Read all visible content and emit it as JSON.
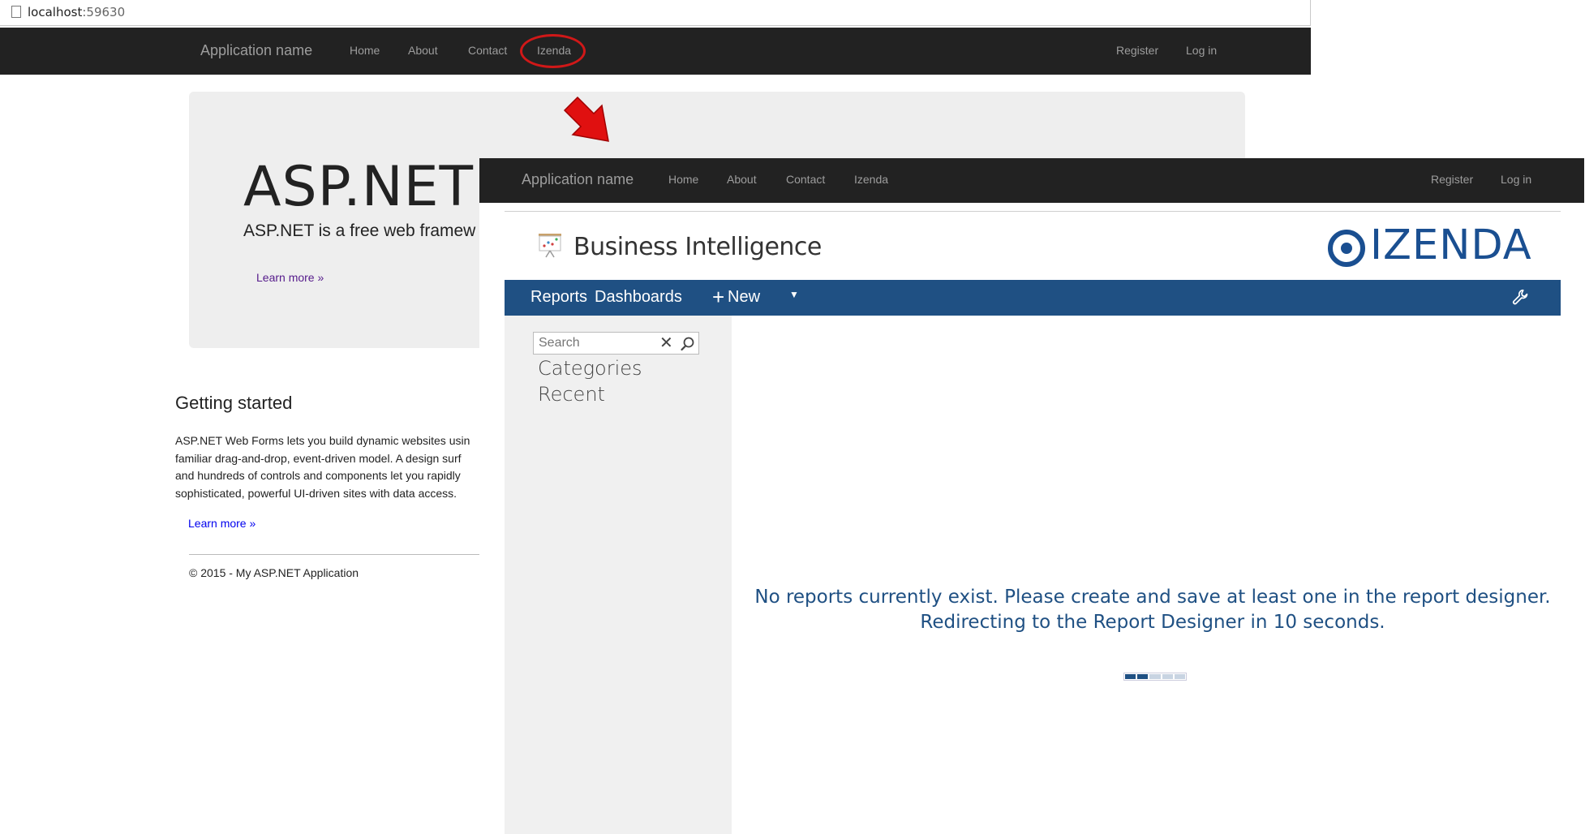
{
  "browser": {
    "url_host": "localhost",
    "url_port": ":59630"
  },
  "back_page": {
    "nav": {
      "brand": "Application name",
      "links": [
        "Home",
        "About",
        "Contact",
        "Izenda"
      ],
      "right_links": [
        "Register",
        "Log in"
      ]
    },
    "jumbotron": {
      "heading": "ASP.NET",
      "lead": "ASP.NET is a free web framew",
      "learn_more": "Learn more »"
    },
    "getting_started": {
      "title": "Getting started",
      "paragraph": "ASP.NET Web Forms lets you build dynamic websites usin\nfamiliar drag-and-drop, event-driven model. A design surf\nand hundreds of controls and components let you rapidly\nsophisticated, powerful UI-driven sites with data access.",
      "learn_more": "Learn more »"
    },
    "footer": "© 2015 - My ASP.NET Application"
  },
  "front_page": {
    "nav": {
      "brand": "Application name",
      "links": [
        "Home",
        "About",
        "Contact",
        "Izenda"
      ],
      "right_links": [
        "Register",
        "Log in"
      ]
    },
    "header": {
      "title": "Business Intelligence",
      "logo_text": "IZENDA"
    },
    "toolbar": {
      "reports": "Reports",
      "dashboards": "Dashboards",
      "new": "New"
    },
    "sidebar": {
      "search_placeholder": "Search",
      "categories": "Categories",
      "recent": "Recent"
    },
    "message": {
      "line1": "No reports currently exist. Please create and save at least one in the report designer.",
      "line2": "Redirecting to the Report Designer in 10 seconds."
    },
    "loader": {
      "segments_total": 5,
      "segments_active": 2
    }
  },
  "colors": {
    "navbar": "#222222",
    "toolbar": "#1f5083",
    "annotation": "#d01818",
    "message": "#1f5083"
  }
}
